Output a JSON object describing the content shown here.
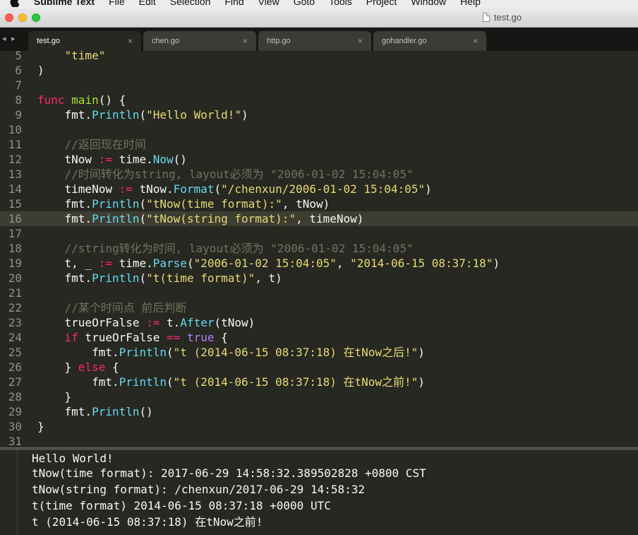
{
  "menubar": {
    "app_name": "Sublime Text",
    "menus": [
      "File",
      "Edit",
      "Selection",
      "Find",
      "View",
      "Goto",
      "Tools",
      "Project",
      "Window",
      "Help"
    ]
  },
  "window": {
    "title": "test.go"
  },
  "tabs": [
    {
      "label": "test.go",
      "active": true
    },
    {
      "label": "chen.go",
      "active": false
    },
    {
      "label": "http.go",
      "active": false
    },
    {
      "label": "gohandler.go",
      "active": false
    }
  ],
  "tab_nav": "◂ ▸",
  "tab_close_glyph": "×",
  "colors": {
    "background": "#272822",
    "keyword": "#f92672",
    "function": "#a6e22e",
    "method": "#66d9ef",
    "string": "#e6db74",
    "comment": "#75715e",
    "boolean": "#ae81ff",
    "highlight_line": "#3e3d32"
  },
  "editor": {
    "highlighted_line": 16,
    "lines": [
      {
        "n": "5",
        "t": [
          [
            "    ",
            ""
          ],
          [
            "\"time\"",
            "st"
          ]
        ]
      },
      {
        "n": "6",
        "t": [
          [
            ")",
            ""
          ]
        ]
      },
      {
        "n": "7",
        "t": []
      },
      {
        "n": "8",
        "t": [
          [
            "func",
            "kw"
          ],
          [
            " ",
            ""
          ],
          [
            "main",
            "fn"
          ],
          [
            "() {",
            ""
          ]
        ]
      },
      {
        "n": "9",
        "t": [
          [
            "    fmt.",
            ""
          ],
          [
            "Println",
            "mt"
          ],
          [
            "(",
            ""
          ],
          [
            "\"Hello World!\"",
            "st"
          ],
          [
            ")",
            ""
          ]
        ]
      },
      {
        "n": "10",
        "t": []
      },
      {
        "n": "11",
        "t": [
          [
            "    ",
            ""
          ],
          [
            "//返回现在时间",
            "cm"
          ]
        ]
      },
      {
        "n": "12",
        "t": [
          [
            "    tNow ",
            ""
          ],
          [
            ":=",
            "op"
          ],
          [
            " time.",
            ""
          ],
          [
            "Now",
            "mt"
          ],
          [
            "()",
            ""
          ]
        ]
      },
      {
        "n": "13",
        "t": [
          [
            "    ",
            ""
          ],
          [
            "//时间转化为string, layout必须为 \"2006-01-02 15:04:05\"",
            "cm"
          ]
        ]
      },
      {
        "n": "14",
        "t": [
          [
            "    timeNow ",
            ""
          ],
          [
            ":=",
            "op"
          ],
          [
            " tNow.",
            ""
          ],
          [
            "Format",
            "mt"
          ],
          [
            "(",
            ""
          ],
          [
            "\"/chenxun/2006-01-02 15:04:05\"",
            "st"
          ],
          [
            ")",
            ""
          ]
        ]
      },
      {
        "n": "15",
        "t": [
          [
            "    fmt.",
            ""
          ],
          [
            "Println",
            "mt"
          ],
          [
            "(",
            ""
          ],
          [
            "\"tNow(time format):\"",
            "st"
          ],
          [
            ", tNow)",
            ""
          ]
        ]
      },
      {
        "n": "16",
        "t": [
          [
            "    fmt.",
            ""
          ],
          [
            "Println",
            "mt"
          ],
          [
            "(",
            ""
          ],
          [
            "\"tNow(string format):\"",
            "st"
          ],
          [
            ", timeNow)",
            ""
          ]
        ]
      },
      {
        "n": "17",
        "t": []
      },
      {
        "n": "18",
        "t": [
          [
            "    ",
            ""
          ],
          [
            "//string转化为时间, layout必须为 \"2006-01-02 15:04:05\"",
            "cm"
          ]
        ]
      },
      {
        "n": "19",
        "t": [
          [
            "    t, _ ",
            ""
          ],
          [
            ":=",
            "op"
          ],
          [
            " time.",
            ""
          ],
          [
            "Parse",
            "mt"
          ],
          [
            "(",
            ""
          ],
          [
            "\"2006-01-02 15:04:05\"",
            "st"
          ],
          [
            ", ",
            ""
          ],
          [
            "\"2014-06-15 08:37:18\"",
            "st"
          ],
          [
            ")",
            ""
          ]
        ]
      },
      {
        "n": "20",
        "t": [
          [
            "    fmt.",
            ""
          ],
          [
            "Println",
            "mt"
          ],
          [
            "(",
            ""
          ],
          [
            "\"t(time format)\"",
            "st"
          ],
          [
            ", t)",
            ""
          ]
        ]
      },
      {
        "n": "21",
        "t": []
      },
      {
        "n": "22",
        "t": [
          [
            "    ",
            ""
          ],
          [
            "//某个时间点 前后判断",
            "cm"
          ]
        ]
      },
      {
        "n": "23",
        "t": [
          [
            "    trueOrFalse ",
            ""
          ],
          [
            ":=",
            "op"
          ],
          [
            " t.",
            ""
          ],
          [
            "After",
            "mt"
          ],
          [
            "(tNow)",
            ""
          ]
        ]
      },
      {
        "n": "24",
        "t": [
          [
            "    ",
            ""
          ],
          [
            "if",
            "kw"
          ],
          [
            " trueOrFalse ",
            ""
          ],
          [
            "==",
            "op"
          ],
          [
            " ",
            ""
          ],
          [
            "true",
            "bool"
          ],
          [
            " {",
            ""
          ]
        ]
      },
      {
        "n": "25",
        "t": [
          [
            "        fmt.",
            ""
          ],
          [
            "Println",
            "mt"
          ],
          [
            "(",
            ""
          ],
          [
            "\"t (2014-06-15 08:37:18) 在tNow之后!\"",
            "st"
          ],
          [
            ")",
            ""
          ]
        ]
      },
      {
        "n": "26",
        "t": [
          [
            "    } ",
            ""
          ],
          [
            "else",
            "kw"
          ],
          [
            " {",
            ""
          ]
        ]
      },
      {
        "n": "27",
        "t": [
          [
            "        fmt.",
            ""
          ],
          [
            "Println",
            "mt"
          ],
          [
            "(",
            ""
          ],
          [
            "\"t (2014-06-15 08:37:18) 在tNow之前!\"",
            "st"
          ],
          [
            ")",
            ""
          ]
        ]
      },
      {
        "n": "28",
        "t": [
          [
            "    }",
            ""
          ]
        ]
      },
      {
        "n": "29",
        "t": [
          [
            "    fmt.",
            ""
          ],
          [
            "Println",
            "mt"
          ],
          [
            "()",
            ""
          ]
        ]
      },
      {
        "n": "30",
        "t": [
          [
            "}",
            ""
          ]
        ]
      },
      {
        "n": "31",
        "t": []
      }
    ]
  },
  "output": {
    "lines": [
      "Hello World!",
      "tNow(time format): 2017-06-29 14:58:32.389502828 +0800 CST",
      "tNow(string format): /chenxun/2017-06-29 14:58:32",
      "t(time format) 2014-06-15 08:37:18 +0000 UTC",
      "t (2014-06-15 08:37:18) 在tNow之前!"
    ]
  }
}
